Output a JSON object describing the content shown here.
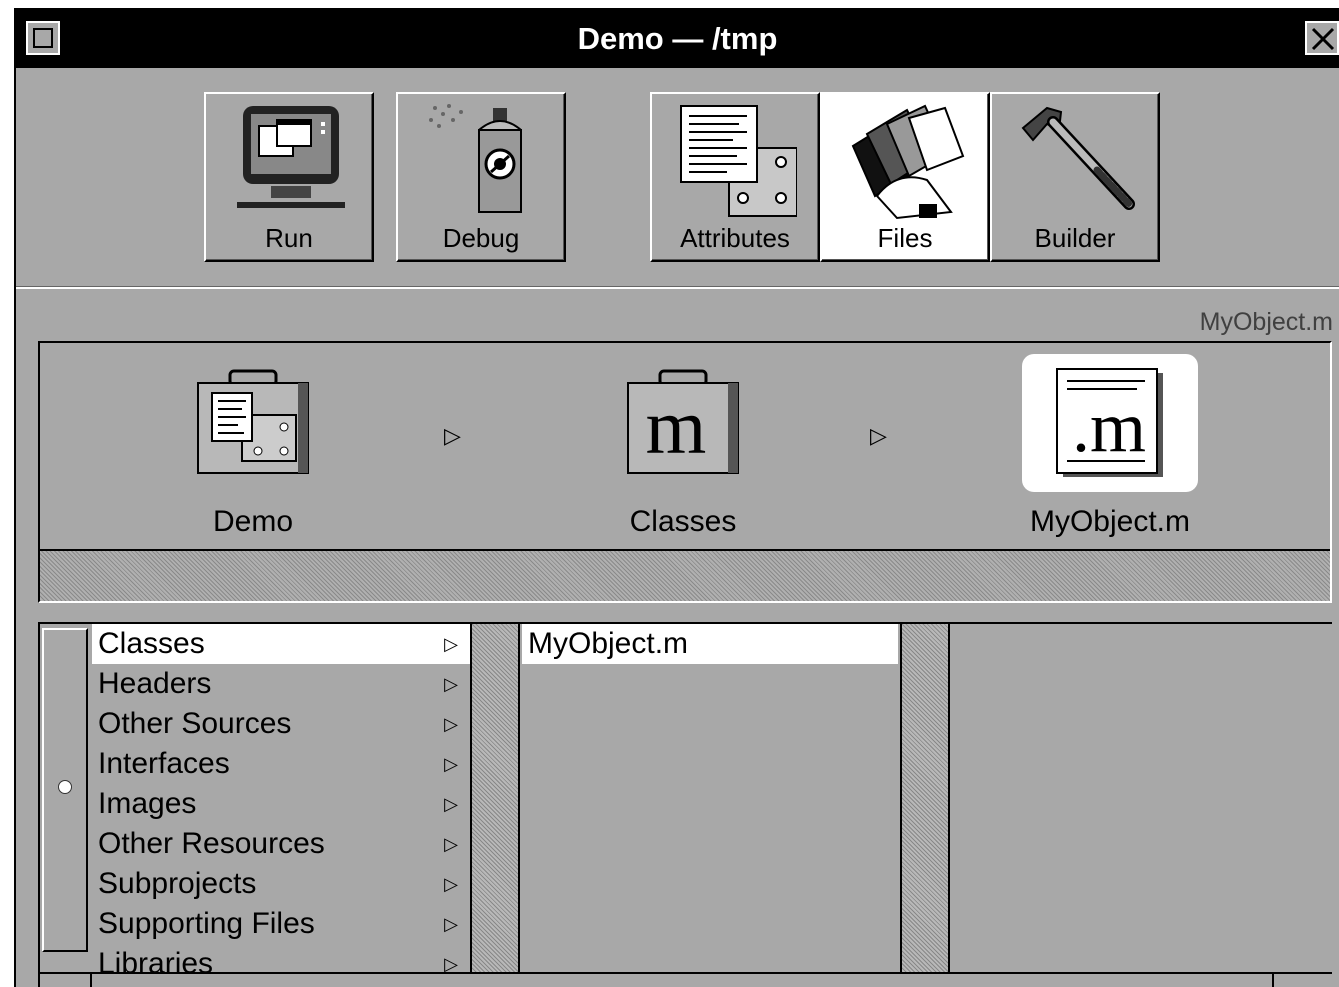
{
  "window": {
    "title": "Demo — /tmp"
  },
  "toolbar": {
    "buttons": [
      {
        "label": "Run"
      },
      {
        "label": "Debug"
      },
      {
        "label": "Attributes"
      },
      {
        "label": "Files"
      },
      {
        "label": "Builder"
      }
    ]
  },
  "path_label": "MyObject.m",
  "path": [
    {
      "label": "Demo"
    },
    {
      "label": "Classes"
    },
    {
      "label": "MyObject.m"
    }
  ],
  "arrow_glyph": "▷",
  "browser": {
    "column1": [
      {
        "label": "Classes"
      },
      {
        "label": "Headers"
      },
      {
        "label": "Other Sources"
      },
      {
        "label": "Interfaces"
      },
      {
        "label": "Images"
      },
      {
        "label": "Other Resources"
      },
      {
        "label": "Subprojects"
      },
      {
        "label": "Supporting Files"
      },
      {
        "label": "Libraries"
      }
    ],
    "column2": [
      {
        "label": "MyObject.m"
      }
    ]
  }
}
